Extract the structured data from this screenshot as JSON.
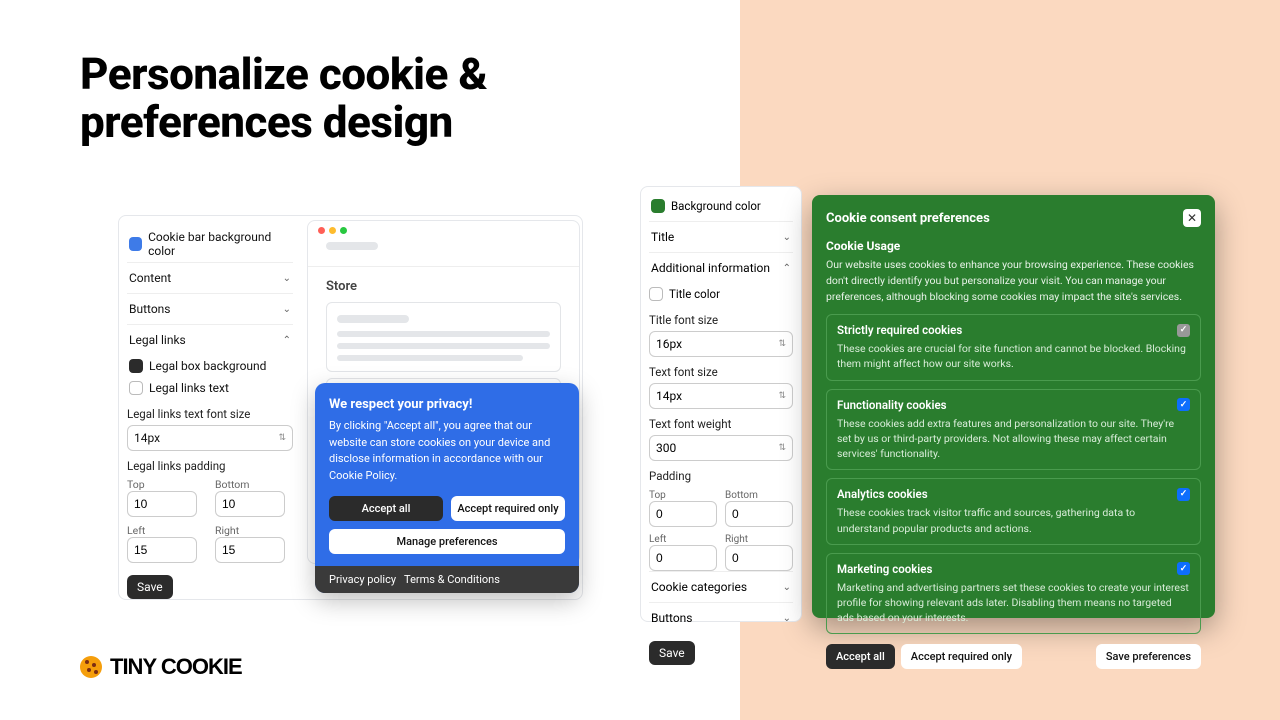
{
  "heading": "Personalize cookie & preferences design",
  "logo": "Tiny Cookie",
  "panel1": {
    "bg_color_label": "Cookie bar background color",
    "accordions": {
      "content": "Content",
      "buttons": "Buttons",
      "legal": "Legal links"
    },
    "legal_box_bg": "Legal box background",
    "legal_links_text": "Legal links text",
    "font_size_label": "Legal links text font size",
    "font_size_value": "14px",
    "padding_label": "Legal links padding",
    "pad": {
      "top_l": "Top",
      "top_v": "10",
      "bottom_l": "Bottom",
      "bottom_v": "10",
      "left_l": "Left",
      "left_v": "15",
      "right_l": "Right",
      "right_v": "15"
    },
    "save": "Save"
  },
  "store": {
    "title": "Store"
  },
  "cookie_pop": {
    "title": "We respect your privacy!",
    "body": "By clicking \"Accept all\", you agree that our website can store cookies on your device and disclose information in accordance with our Cookie Policy.",
    "accept_all": "Accept all",
    "accept_required": "Accept required only",
    "manage": "Manage preferences",
    "privacy": "Privacy policy",
    "terms": "Terms & Conditions"
  },
  "panel2": {
    "bg_color": "Background color",
    "title_section": "Title",
    "additional": "Additional information",
    "title_color": "Title color",
    "title_font_size": "Title font size",
    "title_font_size_v": "16px",
    "text_font_size": "Text font size",
    "text_font_size_v": "14px",
    "text_font_weight": "Text font weight",
    "text_font_weight_v": "300",
    "padding": "Padding",
    "pad": {
      "top_l": "Top",
      "top_v": "0",
      "bottom_l": "Bottom",
      "bottom_v": "0",
      "left_l": "Left",
      "left_v": "0",
      "right_l": "Right",
      "right_v": "0"
    },
    "cookie_categories": "Cookie categories",
    "buttons": "Buttons",
    "save": "Save"
  },
  "panel3": {
    "title": "Cookie consent preferences",
    "usage_title": "Cookie Usage",
    "usage_text": "Our website uses cookies to enhance your browsing experience. These cookies don't directly identify you but personalize your visit. You can manage your preferences, although blocking some cookies may impact the site's services.",
    "cats": [
      {
        "title": "Strictly required cookies",
        "desc": "These cookies are crucial for site function and cannot be blocked. Blocking them might affect how our site works.",
        "locked": true
      },
      {
        "title": "Functionality cookies",
        "desc": "These cookies add extra features and personalization to our site. They're set by us or third-party providers. Not allowing these may affect certain services' functionality.",
        "locked": false
      },
      {
        "title": "Analytics cookies",
        "desc": "These cookies track visitor traffic and sources, gathering data to understand popular products and actions.",
        "locked": false
      },
      {
        "title": "Marketing cookies",
        "desc": "Marketing and advertising partners set these cookies to create your interest profile for showing relevant ads later. Disabling them means no targeted ads based on your interests.",
        "locked": false
      }
    ],
    "accept_all": "Accept all",
    "accept_required": "Accept required only",
    "save_prefs": "Save preferences"
  }
}
